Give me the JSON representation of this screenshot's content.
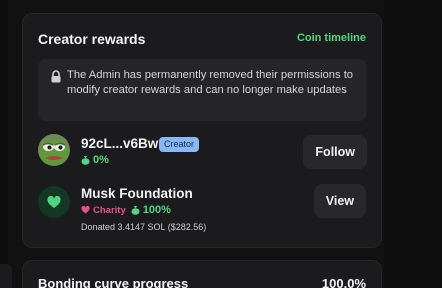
{
  "rewards": {
    "title": "Creator rewards",
    "timeline_link": "Coin timeline",
    "notice_text": "The Admin has permanently removed their permissions to modify creator rewards and can no longer make updates",
    "creator": {
      "name": "92cL...v6Bw",
      "badge": "Creator",
      "share": "0%",
      "button": "Follow"
    },
    "charity": {
      "name": "Musk Foundation",
      "badge": "Charity",
      "share": "100%",
      "donated": "Donated 3.4147 SOL ($282.56)",
      "button": "View"
    }
  },
  "bonding": {
    "title": "Bonding curve progress",
    "value": "100.0%"
  },
  "colors": {
    "accent_green": "#53d67e",
    "charity_pink": "#ec4f87",
    "creator_badge": "#8ab7f5"
  }
}
